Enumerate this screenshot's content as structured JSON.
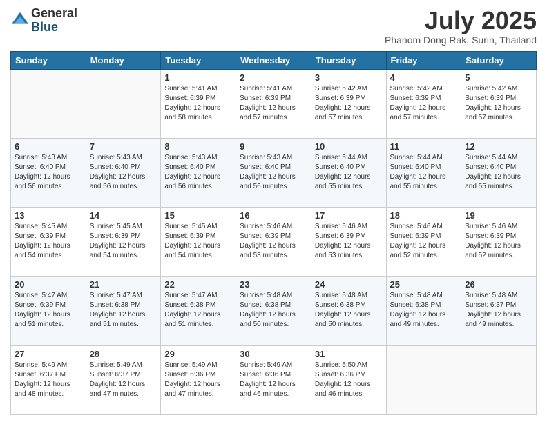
{
  "logo": {
    "general": "General",
    "blue": "Blue"
  },
  "title": "July 2025",
  "subtitle": "Phanom Dong Rak, Surin, Thailand",
  "days_of_week": [
    "Sunday",
    "Monday",
    "Tuesday",
    "Wednesday",
    "Thursday",
    "Friday",
    "Saturday"
  ],
  "weeks": [
    [
      {
        "day": "",
        "info": ""
      },
      {
        "day": "",
        "info": ""
      },
      {
        "day": "1",
        "info": "Sunrise: 5:41 AM\nSunset: 6:39 PM\nDaylight: 12 hours and 58 minutes."
      },
      {
        "day": "2",
        "info": "Sunrise: 5:41 AM\nSunset: 6:39 PM\nDaylight: 12 hours and 57 minutes."
      },
      {
        "day": "3",
        "info": "Sunrise: 5:42 AM\nSunset: 6:39 PM\nDaylight: 12 hours and 57 minutes."
      },
      {
        "day": "4",
        "info": "Sunrise: 5:42 AM\nSunset: 6:39 PM\nDaylight: 12 hours and 57 minutes."
      },
      {
        "day": "5",
        "info": "Sunrise: 5:42 AM\nSunset: 6:39 PM\nDaylight: 12 hours and 57 minutes."
      }
    ],
    [
      {
        "day": "6",
        "info": "Sunrise: 5:43 AM\nSunset: 6:40 PM\nDaylight: 12 hours and 56 minutes."
      },
      {
        "day": "7",
        "info": "Sunrise: 5:43 AM\nSunset: 6:40 PM\nDaylight: 12 hours and 56 minutes."
      },
      {
        "day": "8",
        "info": "Sunrise: 5:43 AM\nSunset: 6:40 PM\nDaylight: 12 hours and 56 minutes."
      },
      {
        "day": "9",
        "info": "Sunrise: 5:43 AM\nSunset: 6:40 PM\nDaylight: 12 hours and 56 minutes."
      },
      {
        "day": "10",
        "info": "Sunrise: 5:44 AM\nSunset: 6:40 PM\nDaylight: 12 hours and 55 minutes."
      },
      {
        "day": "11",
        "info": "Sunrise: 5:44 AM\nSunset: 6:40 PM\nDaylight: 12 hours and 55 minutes."
      },
      {
        "day": "12",
        "info": "Sunrise: 5:44 AM\nSunset: 6:40 PM\nDaylight: 12 hours and 55 minutes."
      }
    ],
    [
      {
        "day": "13",
        "info": "Sunrise: 5:45 AM\nSunset: 6:39 PM\nDaylight: 12 hours and 54 minutes."
      },
      {
        "day": "14",
        "info": "Sunrise: 5:45 AM\nSunset: 6:39 PM\nDaylight: 12 hours and 54 minutes."
      },
      {
        "day": "15",
        "info": "Sunrise: 5:45 AM\nSunset: 6:39 PM\nDaylight: 12 hours and 54 minutes."
      },
      {
        "day": "16",
        "info": "Sunrise: 5:46 AM\nSunset: 6:39 PM\nDaylight: 12 hours and 53 minutes."
      },
      {
        "day": "17",
        "info": "Sunrise: 5:46 AM\nSunset: 6:39 PM\nDaylight: 12 hours and 53 minutes."
      },
      {
        "day": "18",
        "info": "Sunrise: 5:46 AM\nSunset: 6:39 PM\nDaylight: 12 hours and 52 minutes."
      },
      {
        "day": "19",
        "info": "Sunrise: 5:46 AM\nSunset: 6:39 PM\nDaylight: 12 hours and 52 minutes."
      }
    ],
    [
      {
        "day": "20",
        "info": "Sunrise: 5:47 AM\nSunset: 6:39 PM\nDaylight: 12 hours and 51 minutes."
      },
      {
        "day": "21",
        "info": "Sunrise: 5:47 AM\nSunset: 6:38 PM\nDaylight: 12 hours and 51 minutes."
      },
      {
        "day": "22",
        "info": "Sunrise: 5:47 AM\nSunset: 6:38 PM\nDaylight: 12 hours and 51 minutes."
      },
      {
        "day": "23",
        "info": "Sunrise: 5:48 AM\nSunset: 6:38 PM\nDaylight: 12 hours and 50 minutes."
      },
      {
        "day": "24",
        "info": "Sunrise: 5:48 AM\nSunset: 6:38 PM\nDaylight: 12 hours and 50 minutes."
      },
      {
        "day": "25",
        "info": "Sunrise: 5:48 AM\nSunset: 6:38 PM\nDaylight: 12 hours and 49 minutes."
      },
      {
        "day": "26",
        "info": "Sunrise: 5:48 AM\nSunset: 6:37 PM\nDaylight: 12 hours and 49 minutes."
      }
    ],
    [
      {
        "day": "27",
        "info": "Sunrise: 5:49 AM\nSunset: 6:37 PM\nDaylight: 12 hours and 48 minutes."
      },
      {
        "day": "28",
        "info": "Sunrise: 5:49 AM\nSunset: 6:37 PM\nDaylight: 12 hours and 47 minutes."
      },
      {
        "day": "29",
        "info": "Sunrise: 5:49 AM\nSunset: 6:36 PM\nDaylight: 12 hours and 47 minutes."
      },
      {
        "day": "30",
        "info": "Sunrise: 5:49 AM\nSunset: 6:36 PM\nDaylight: 12 hours and 46 minutes."
      },
      {
        "day": "31",
        "info": "Sunrise: 5:50 AM\nSunset: 6:36 PM\nDaylight: 12 hours and 46 minutes."
      },
      {
        "day": "",
        "info": ""
      },
      {
        "day": "",
        "info": ""
      }
    ]
  ]
}
